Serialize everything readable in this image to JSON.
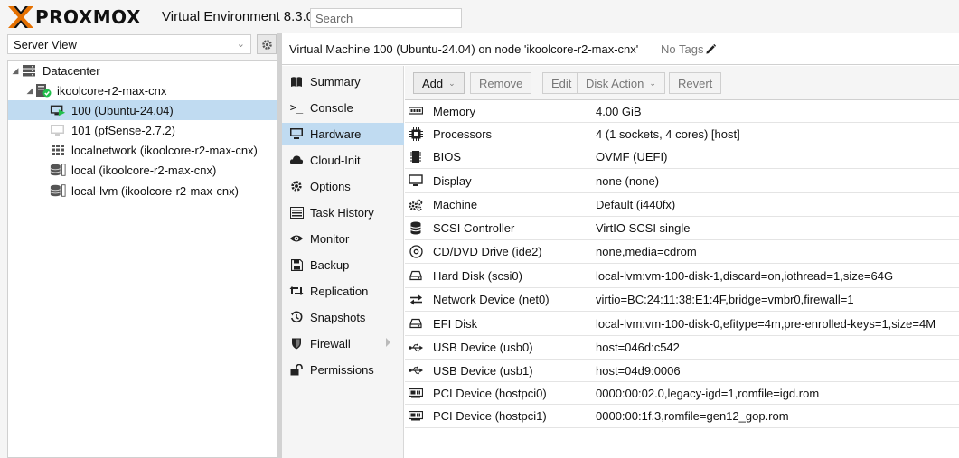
{
  "header": {
    "logo_text": "PROXMOX",
    "product_title": "Virtual Environment 8.3.0",
    "search_placeholder": "Search",
    "accent_color": "#e57000"
  },
  "left_panel": {
    "view_selected": "Server View",
    "tree": [
      {
        "label": "Datacenter",
        "icon": "datacenter-icon"
      },
      {
        "label": "ikoolcore-r2-max-cnx",
        "icon": "node-online-icon"
      },
      {
        "label": "100 (Ubuntu-24.04)",
        "icon": "vm-running-icon",
        "selected": true
      },
      {
        "label": "101 (pfSense-2.7.2)",
        "icon": "vm-stopped-icon"
      },
      {
        "label": "localnetwork (ikoolcore-r2-max-cnx)",
        "icon": "network-zone-icon"
      },
      {
        "label": "local (ikoolcore-r2-max-cnx)",
        "icon": "storage-icon"
      },
      {
        "label": "local-lvm (ikoolcore-r2-max-cnx)",
        "icon": "storage-icon"
      }
    ]
  },
  "vm_header": {
    "title": "Virtual Machine 100 (Ubuntu-24.04) on node 'ikoolcore-r2-max-cnx'",
    "tags_label": "No Tags"
  },
  "nav": {
    "items": [
      {
        "label": "Summary",
        "icon": "book-icon"
      },
      {
        "label": "Console",
        "icon": "terminal-icon"
      },
      {
        "label": "Hardware",
        "icon": "desktop-icon",
        "active": true
      },
      {
        "label": "Cloud-Init",
        "icon": "cloud-icon"
      },
      {
        "label": "Options",
        "icon": "gear-icon"
      },
      {
        "label": "Task History",
        "icon": "list-icon"
      },
      {
        "label": "Monitor",
        "icon": "eye-icon"
      },
      {
        "label": "Backup",
        "icon": "floppy-icon"
      },
      {
        "label": "Replication",
        "icon": "retweet-icon"
      },
      {
        "label": "Snapshots",
        "icon": "history-icon"
      },
      {
        "label": "Firewall",
        "icon": "shield-icon",
        "has_submenu": true
      },
      {
        "label": "Permissions",
        "icon": "unlock-icon"
      }
    ]
  },
  "toolbar": {
    "add": "Add",
    "remove": "Remove",
    "edit": "Edit",
    "disk_action": "Disk Action",
    "revert": "Revert"
  },
  "hardware": [
    {
      "name": "Memory",
      "value": "4.00 GiB",
      "icon": "memory-icon"
    },
    {
      "name": "Processors",
      "value": "4 (1 sockets, 4 cores) [host]",
      "icon": "cpu-icon"
    },
    {
      "name": "BIOS",
      "value": "OVMF (UEFI)",
      "icon": "microchip-icon"
    },
    {
      "name": "Display",
      "value": "none (none)",
      "icon": "monitor-icon"
    },
    {
      "name": "Machine",
      "value": "Default (i440fx)",
      "icon": "cogs-icon"
    },
    {
      "name": "SCSI Controller",
      "value": "VirtIO SCSI single",
      "icon": "database-icon"
    },
    {
      "name": "CD/DVD Drive (ide2)",
      "value": "none,media=cdrom",
      "icon": "cdrom-icon"
    },
    {
      "name": "Hard Disk (scsi0)",
      "value": "local-lvm:vm-100-disk-1,discard=on,iothread=1,size=64G",
      "icon": "hdd-icon"
    },
    {
      "name": "Network Device (net0)",
      "value": "virtio=BC:24:11:38:E1:4F,bridge=vmbr0,firewall=1",
      "icon": "exchange-icon"
    },
    {
      "name": "EFI Disk",
      "value": "local-lvm:vm-100-disk-0,efitype=4m,pre-enrolled-keys=1,size=4M",
      "icon": "hdd-icon"
    },
    {
      "name": "USB Device (usb0)",
      "value": "host=046d:c542",
      "icon": "usb-icon"
    },
    {
      "name": "USB Device (usb1)",
      "value": "host=04d9:0006",
      "icon": "usb-icon"
    },
    {
      "name": "PCI Device (hostpci0)",
      "value": "0000:00:02.0,legacy-igd=1,romfile=igd.rom",
      "icon": "pci-card-icon"
    },
    {
      "name": "PCI Device (hostpci1)",
      "value": "0000:00:1f.3,romfile=gen12_gop.rom",
      "icon": "pci-card-icon"
    }
  ]
}
